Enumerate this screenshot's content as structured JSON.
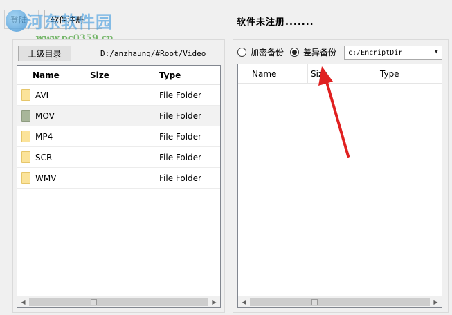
{
  "toolbar": {
    "login_label": "登陆",
    "register_label": "软件注册",
    "status_text": "软件未注册......."
  },
  "watermark": {
    "title": "河东软件园",
    "url": "www.pc0359.cn"
  },
  "left_panel": {
    "up_button_label": "上级目录",
    "path": "D:/anzhaung/#Root/Video",
    "columns": {
      "name": "Name",
      "size": "Size",
      "type": "Type"
    },
    "rows": [
      {
        "name": "AVI",
        "size": "",
        "type": "File Folder"
      },
      {
        "name": "MOV",
        "size": "",
        "type": "File Folder"
      },
      {
        "name": "MP4",
        "size": "",
        "type": "File Folder"
      },
      {
        "name": "SCR",
        "size": "",
        "type": "File Folder"
      },
      {
        "name": "WMV",
        "size": "",
        "type": "File Folder"
      }
    ],
    "selected_row_index": 1
  },
  "right_panel": {
    "radio_encrypt_label": "加密备份",
    "radio_diff_label": "差异备份",
    "selected_mode": "差异备份",
    "target_dir": "c:/EncriptDir",
    "columns": {
      "name": "Name",
      "size": "Size",
      "type": "Type"
    }
  },
  "colors": {
    "annotation_arrow": "#e02020",
    "folder_fill": "#fbe39a",
    "window_bg": "#f0f0f0"
  }
}
